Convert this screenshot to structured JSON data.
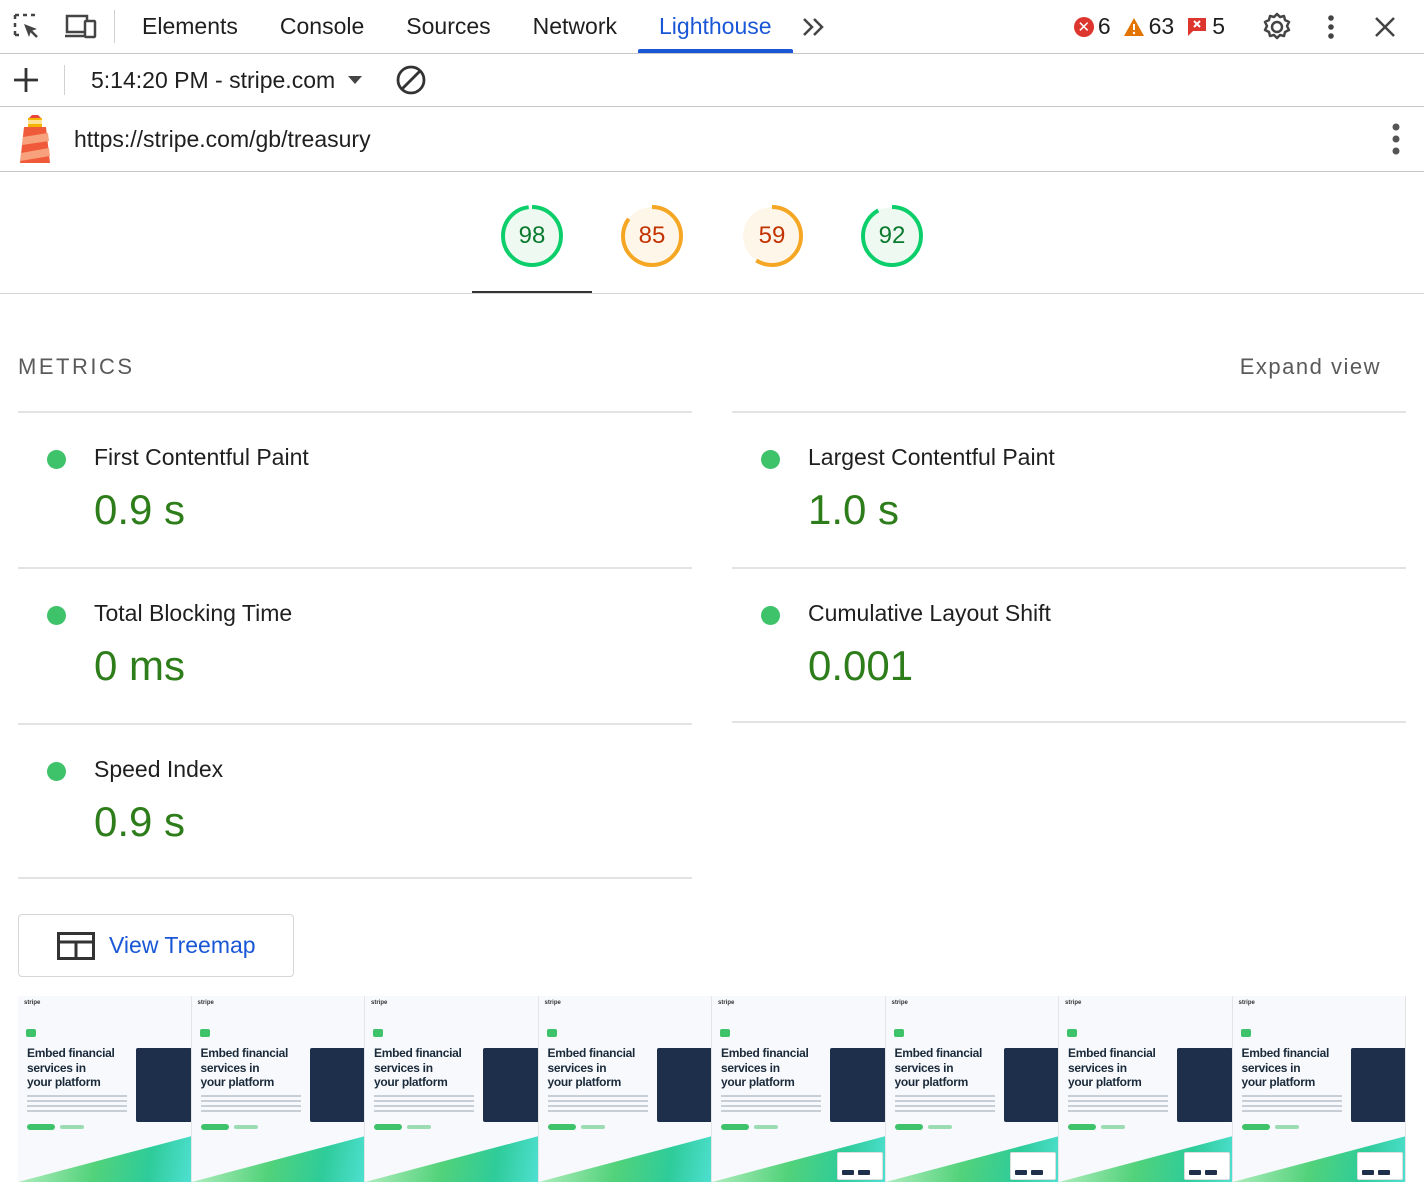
{
  "tabbar": {
    "tabs": [
      {
        "label": "Elements"
      },
      {
        "label": "Console"
      },
      {
        "label": "Sources"
      },
      {
        "label": "Network"
      },
      {
        "label": "Lighthouse"
      }
    ],
    "active_tab": "Lighthouse",
    "errors": "6",
    "warnings": "63",
    "issues": "5"
  },
  "toolbar": {
    "report_label": "5:14:20 PM - stripe.com"
  },
  "urlbar": {
    "url": "https://stripe.com/gb/treasury"
  },
  "gauges": [
    {
      "score": "98",
      "fraction": 0.98,
      "color": "#0cce6b",
      "fill": "#eefaf1",
      "text_color": "#0a7a2f"
    },
    {
      "score": "85",
      "fraction": 0.85,
      "color": "#f5a623",
      "fill": "#fff6ea",
      "text_color": "#c33300"
    },
    {
      "score": "59",
      "fraction": 0.59,
      "color": "#f5a623",
      "fill": "#fff6ea",
      "text_color": "#c33300"
    },
    {
      "score": "92",
      "fraction": 0.92,
      "color": "#0cce6b",
      "fill": "#eefaf1",
      "text_color": "#0a7a2f"
    }
  ],
  "metrics": {
    "title": "METRICS",
    "expand_label": "Expand view",
    "items": [
      {
        "label": "First Contentful Paint",
        "value": "0.9 s"
      },
      {
        "label": "Largest Contentful Paint",
        "value": "1.0 s"
      },
      {
        "label": "Total Blocking Time",
        "value": "0 ms"
      },
      {
        "label": "Cumulative Layout Shift",
        "value": "0.001"
      },
      {
        "label": "Speed Index",
        "value": "0.9 s"
      }
    ]
  },
  "treemap_button": {
    "label": "View Treemap"
  },
  "filmstrip": {
    "frame_count": 8,
    "headline_lines": [
      "Embed financial",
      "services in",
      "your platform"
    ]
  }
}
